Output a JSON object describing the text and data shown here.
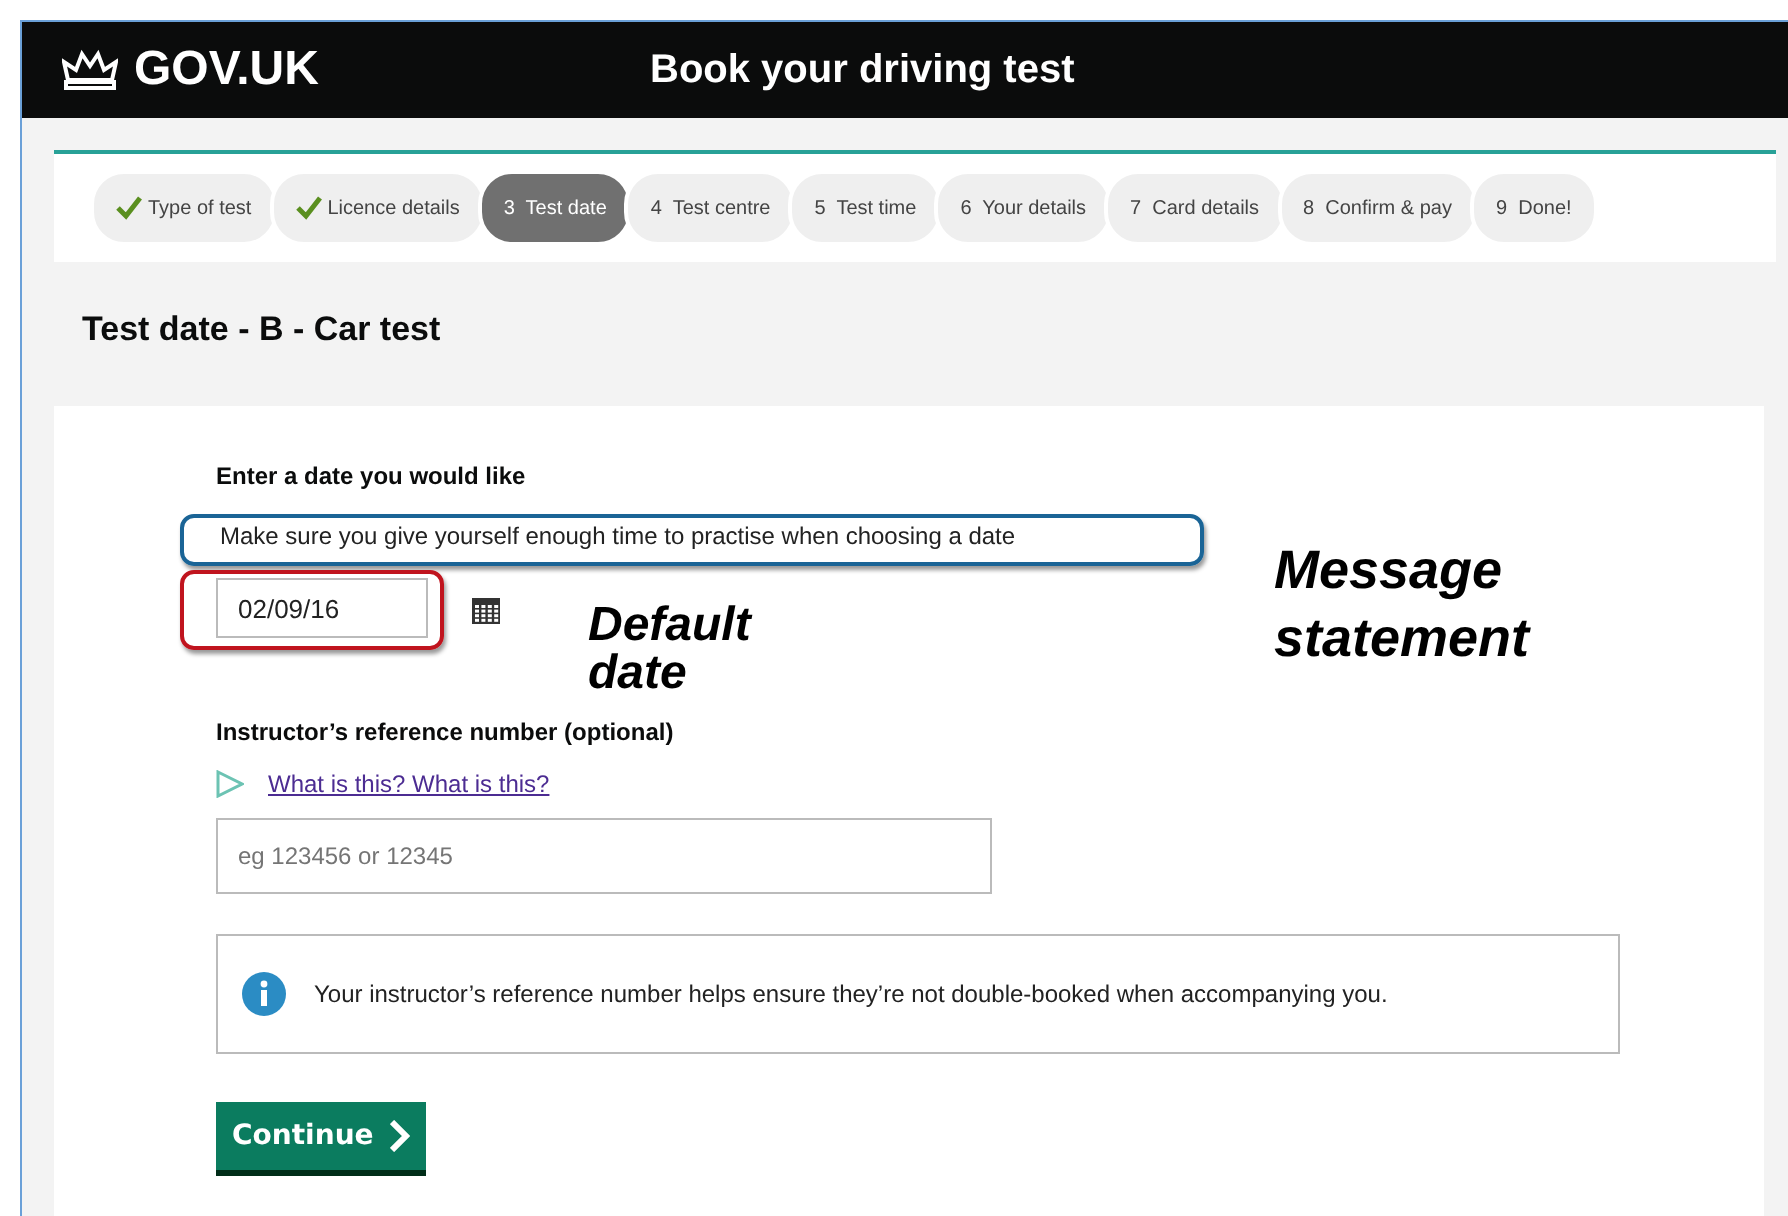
{
  "header": {
    "logo": "GOV.UK",
    "title": "Book your driving test"
  },
  "steps": [
    {
      "label": "Type of test",
      "done": true,
      "selected": false
    },
    {
      "label": "Licence details",
      "done": true,
      "selected": false
    },
    {
      "label": "3  Test date",
      "done": false,
      "selected": true
    },
    {
      "label": "4  Test centre",
      "done": false,
      "selected": false
    },
    {
      "label": "5  Test time",
      "done": false,
      "selected": false
    },
    {
      "label": "6  Your details",
      "done": false,
      "selected": false
    },
    {
      "label": "7  Card details",
      "done": false,
      "selected": false
    },
    {
      "label": "8  Confirm & pay",
      "done": false,
      "selected": false
    },
    {
      "label": "9  Done!",
      "done": false,
      "selected": false
    }
  ],
  "page_title": "Test date - B - Car test",
  "date_question": {
    "label": "Enter a date you would like",
    "hint": "Make sure you give yourself enough time to practise when choosing a date",
    "value": "02/09/16"
  },
  "instructor": {
    "label": "Instructor’s reference number (optional)",
    "link": "What is this? What is this?",
    "placeholder": "eg 123456 or 12345"
  },
  "info": "Your instructor’s reference number helps ensure they’re not double-booked when accompanying you.",
  "button": "Continue",
  "annotations": [
    {
      "text": "Message statement"
    },
    {
      "text": "Default date"
    }
  ]
}
